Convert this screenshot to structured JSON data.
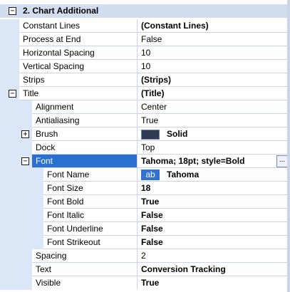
{
  "category": {
    "title": "2. Chart  Additional",
    "toggle": "−"
  },
  "rows": {
    "constant_lines": {
      "name": "Constant Lines",
      "value": "(Constant Lines)"
    },
    "process_at_end": {
      "name": "Process at End",
      "value": "False"
    },
    "horizontal_spacing": {
      "name": "Horizontal Spacing",
      "value": "10"
    },
    "vertical_spacing": {
      "name": "Vertical Spacing",
      "value": "10"
    },
    "strips": {
      "name": "Strips",
      "value": "(Strips)"
    },
    "title": {
      "name": "Title",
      "value": "(Title)",
      "toggle": "−"
    },
    "alignment": {
      "name": "Alignment",
      "value": "Center"
    },
    "antialiasing": {
      "name": "Antialiasing",
      "value": "True"
    },
    "brush": {
      "name": "Brush",
      "value": "Solid",
      "toggle": "+",
      "swatch_color": "#2e3a52"
    },
    "dock": {
      "name": "Dock",
      "value": "Top"
    },
    "font": {
      "name": "Font",
      "value": "Tahoma; 18pt; style=Bold",
      "toggle": "−",
      "ellipsis": "..."
    },
    "font_name": {
      "name": "Font Name",
      "value": "Tahoma",
      "sample": "ab"
    },
    "font_size": {
      "name": "Font Size",
      "value": "18"
    },
    "font_bold": {
      "name": "Font Bold",
      "value": "True"
    },
    "font_italic": {
      "name": "Font Italic",
      "value": "False"
    },
    "font_underline": {
      "name": "Font Underline",
      "value": "False"
    },
    "font_strikeout": {
      "name": "Font Strikeout",
      "value": "False"
    },
    "spacing": {
      "name": "Spacing",
      "value": "2"
    },
    "text": {
      "name": "Text",
      "value": "Conversion Tracking"
    },
    "visible": {
      "name": "Visible",
      "value": "True"
    }
  },
  "colors": {
    "gutter": "#dbe6f6",
    "category": "#d2deef",
    "selection": "#2b6fd0",
    "grid_line": "#c9d6ea"
  }
}
